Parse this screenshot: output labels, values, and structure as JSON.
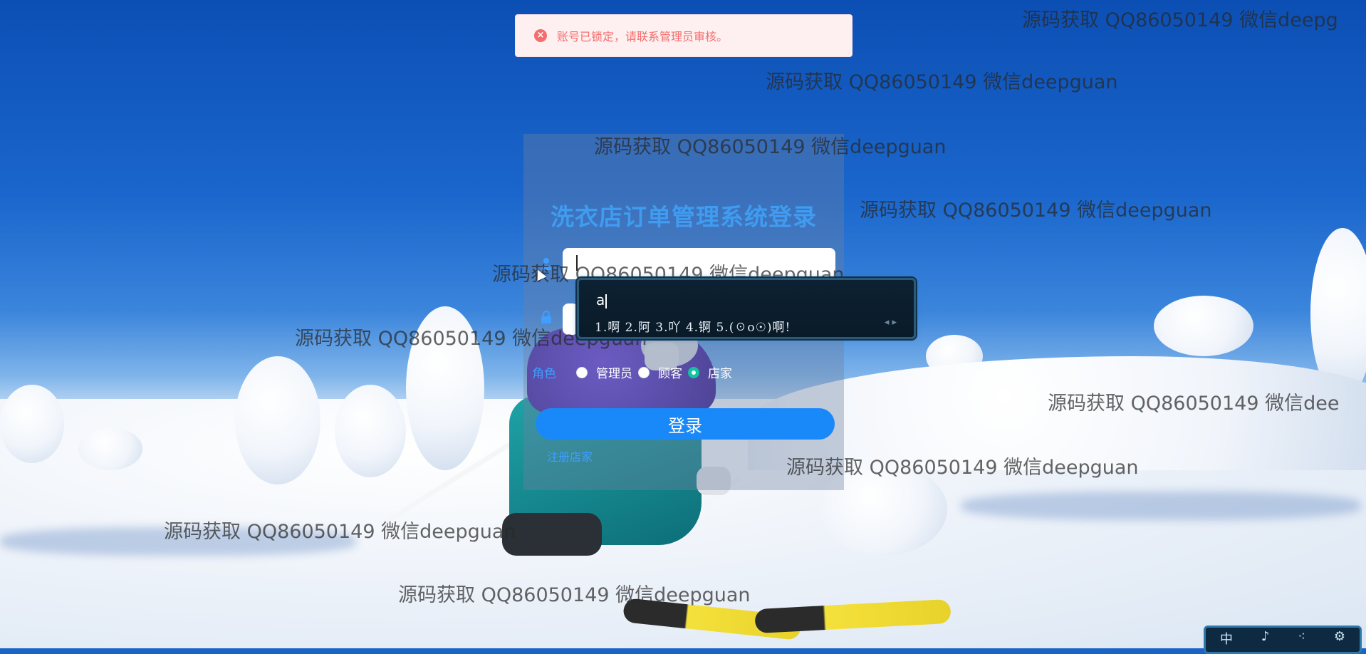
{
  "toast": {
    "icon": "error-circle-icon",
    "message": "账号已锁定，请联系管理员审核。",
    "color": "#f56c6c"
  },
  "login": {
    "title": "洗衣店订单管理系统登录",
    "username_value": "",
    "password_value": "",
    "role_label": "角色",
    "roles": [
      {
        "label": "管理员",
        "checked": false
      },
      {
        "label": "顾客",
        "checked": false
      },
      {
        "label": "店家",
        "checked": true
      }
    ],
    "login_button": "登录",
    "register_link": "注册店家"
  },
  "watermark": {
    "text": "源码获取 QQ86050149 微信deepguan",
    "text_cut_top": "源码获取 QQ86050149 微信deepg",
    "text_cut_right": "源码获取 QQ86050149 微信dee"
  },
  "ime": {
    "input": "a",
    "candidates": "1.啊 2.阿 3.吖 4.锕 5.(☉o☉)啊!",
    "nav": "◂ ▸"
  },
  "ime_toolbar": {
    "items": [
      "中",
      "♪",
      "⁖",
      "⚙"
    ]
  }
}
